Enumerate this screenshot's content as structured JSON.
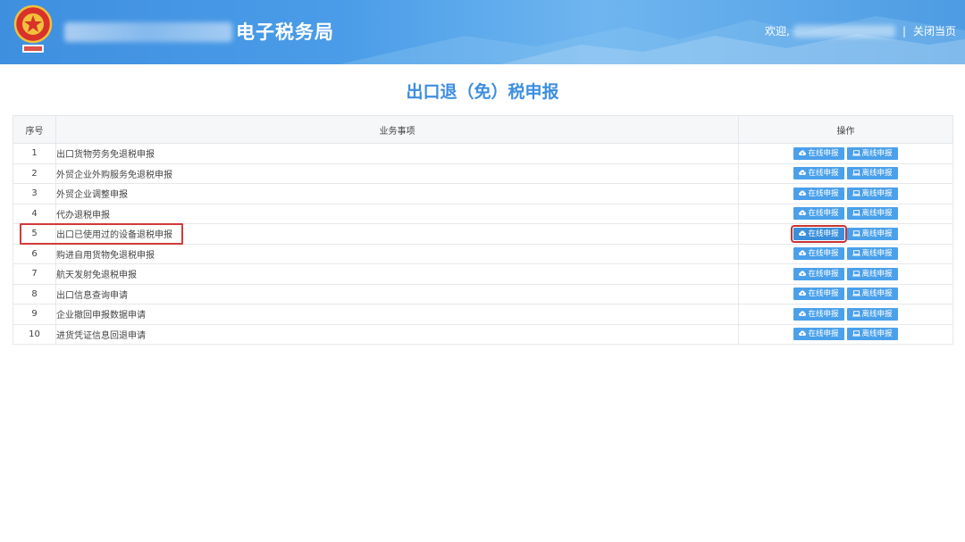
{
  "header": {
    "site_title": "电子税务局",
    "welcome": "欢迎,",
    "separator": "|",
    "close_label": "关闭当页"
  },
  "page": {
    "title": "出口退（免）税申报"
  },
  "table": {
    "headers": [
      "序号",
      "业务事项",
      "操作"
    ],
    "online_label": "在线申报",
    "offline_label": "离线申报",
    "rows": [
      {
        "no": "1",
        "item": "出口货物劳务免退税申报"
      },
      {
        "no": "2",
        "item": "外贸企业外购服务免退税申报"
      },
      {
        "no": "3",
        "item": "外贸企业调整申报"
      },
      {
        "no": "4",
        "item": "代办退税申报"
      },
      {
        "no": "5",
        "item": "出口已使用过的设备退税申报"
      },
      {
        "no": "6",
        "item": "购进自用货物免退税申报"
      },
      {
        "no": "7",
        "item": "航天发射免退税申报"
      },
      {
        "no": "8",
        "item": "出口信息查询申请"
      },
      {
        "no": "9",
        "item": "企业撤回申报数据申请"
      },
      {
        "no": "10",
        "item": "进货凭证信息回退申请"
      }
    ]
  },
  "colors": {
    "header_blue": "#4a9ce8",
    "accent": "#3d8ee0",
    "button": "#4aa0ea",
    "highlight": "#d23a3a"
  }
}
